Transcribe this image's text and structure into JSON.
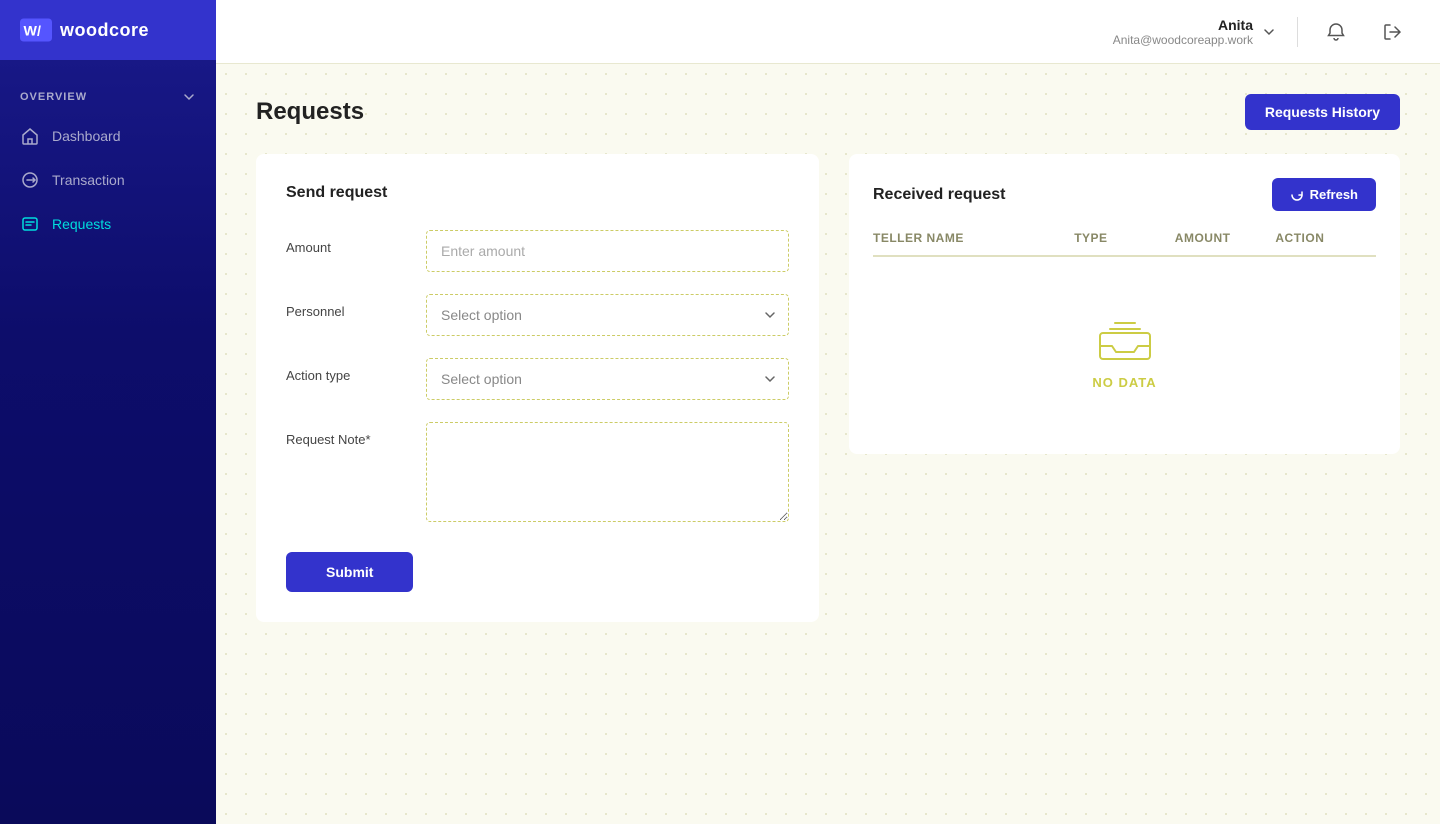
{
  "app": {
    "name": "woodcore",
    "logo_text": "woodcore"
  },
  "sidebar": {
    "section_label": "OVERVIEW",
    "items": [
      {
        "id": "dashboard",
        "label": "Dashboard",
        "icon": "home-icon",
        "active": false
      },
      {
        "id": "transaction",
        "label": "Transaction",
        "icon": "transaction-icon",
        "active": false
      },
      {
        "id": "requests",
        "label": "Requests",
        "icon": "requests-icon",
        "active": true
      }
    ]
  },
  "header": {
    "username": "Anita",
    "email": "Anita@woodcoreapp.work"
  },
  "page": {
    "title": "Requests",
    "history_button": "Requests History"
  },
  "send_request": {
    "title": "Send request",
    "amount_label": "Amount",
    "amount_placeholder": "Enter amount",
    "personnel_label": "Personnel",
    "personnel_placeholder": "Select option",
    "action_type_label": "Action type",
    "action_type_placeholder": "Select option",
    "request_note_label": "Request Note*",
    "submit_button": "Submit"
  },
  "received_request": {
    "title": "Received request",
    "refresh_button": "Refresh",
    "columns": [
      {
        "key": "teller_name",
        "label": "TELLER NAME"
      },
      {
        "key": "type",
        "label": "TYPE"
      },
      {
        "key": "amount",
        "label": "AMOUNT"
      },
      {
        "key": "action",
        "label": "ACTION"
      }
    ],
    "no_data_text": "NO DATA",
    "rows": []
  }
}
